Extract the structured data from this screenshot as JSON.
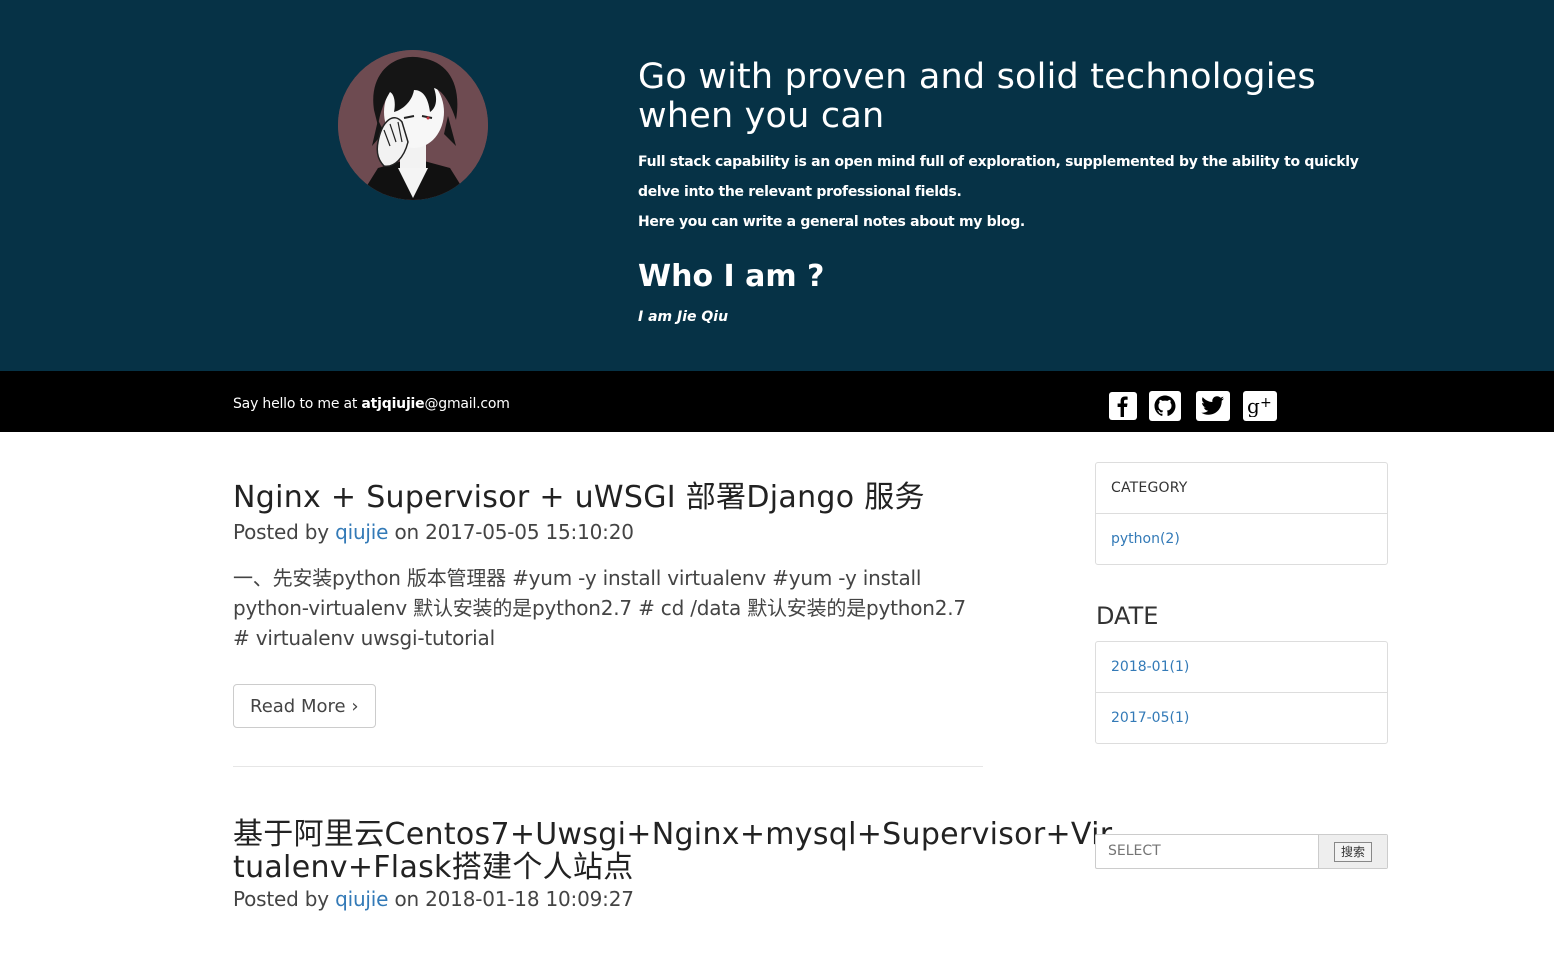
{
  "hero": {
    "title": "Go with proven and solid technologies when you can",
    "description_line1": "Full stack capability is an open mind full of exploration, supplemented by the ability to quickly delve into the relevant professional fields.",
    "description_line2": "Here you can write a general notes about my blog.",
    "subheading": "Who I am ?",
    "name": "I am Jie Qiu",
    "background_color": "#063246"
  },
  "contact": {
    "prefix": "Say hello to me at ",
    "email_user": "atjqiujie",
    "email_domain": "@gmail.com"
  },
  "social": [
    {
      "icon": "facebook-icon",
      "label": "f"
    },
    {
      "icon": "github-icon",
      "label": "github"
    },
    {
      "icon": "twitter-icon",
      "label": "twitter"
    },
    {
      "icon": "google-plus-icon",
      "label": "g+"
    }
  ],
  "posts": [
    {
      "title": "Nginx + Supervisor + uWSGI 部署Django 服务",
      "posted_by_label": "Posted by",
      "author": "qiujie",
      "on_label": "on",
      "date": "2017-05-05 15:10:20",
      "excerpt": "一、先安装python 版本管理器 #yum -y install virtualenv #yum -y install python-virtualenv 默认安装的是python2.7 # cd /data 默认安装的是python2.7 # virtualenv uwsgi-tutorial",
      "read_more": "Read More"
    },
    {
      "title": "基于阿里云Centos7+Uwsgi+Nginx+mysql+Supervisor+Virtualenv+Flask搭建个人站点",
      "posted_by_label": "Posted by",
      "author": "qiujie",
      "on_label": "on",
      "date": "2018-01-18 10:09:27"
    }
  ],
  "sidebar": {
    "category_heading": "CATEGORY",
    "categories": [
      "python(2)"
    ],
    "date_heading": "DATE",
    "dates": [
      "2018-01(1)",
      "2017-05(1)"
    ],
    "search_placeholder": "SELECT",
    "search_button": "搜索"
  },
  "colors": {
    "link": "#337ab7",
    "contact_bar": "#000000"
  }
}
